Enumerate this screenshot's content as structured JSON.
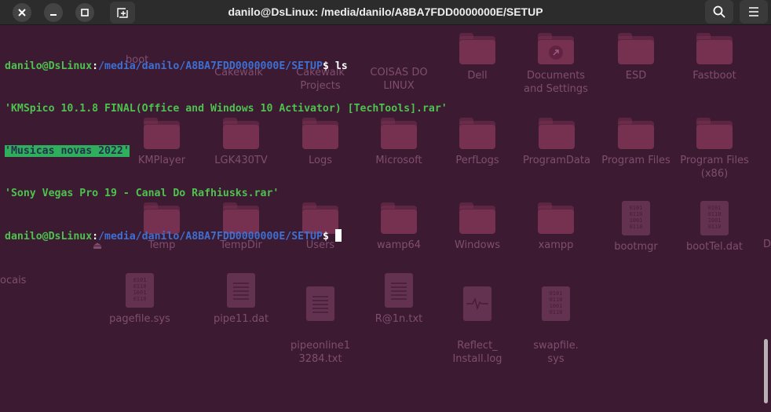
{
  "window": {
    "title": "danilo@DsLinux: /media/danilo/A8BA7FDD0000000E/SETUP"
  },
  "terminal": {
    "prompt_user": "danilo@DsLinux",
    "prompt_sep": ":",
    "prompt_path": "/media/danilo/A8BA7FDD0000000E/SETUP",
    "prompt_symbol": "$",
    "command": " ls",
    "output": [
      "'KMSpico 10.1.8 FINAL(Office and Windows 10 Activator) [TechTools].rar'",
      "'Musicas novas 2022'",
      "'Sony Vegas Pro 19 - Canal Do Rafhiusks.rar'"
    ],
    "colors": {
      "user": "#4ec24e",
      "path": "#3f6fd0",
      "highlight_bg": "#2fae5e",
      "background": "#3b1a32"
    }
  },
  "background_files": {
    "row1": [
      "Cakewalk",
      "Cakewalk Projects",
      "COISAS DO LINUX",
      "Dell",
      "Documents and Settings",
      "ESD",
      "Fastboot"
    ],
    "row1_partial": "boot",
    "row2": [
      "KMPlayer",
      "LGK430TV",
      "Logs",
      "Microsoft",
      "PerfLogs",
      "ProgramData",
      "Program Files",
      "Program Files (x86)"
    ],
    "row3": [
      "Temp",
      "TempDir",
      "Users",
      "wamp64",
      "Windows",
      "xampp",
      "bootmgr",
      "bootTel.dat"
    ],
    "row3_partial": "D",
    "row4": [
      "pagefile.sys",
      "pipe11.dat",
      "pipeonline13284.txt",
      "R@1n.txt",
      "Reflect_Install.log",
      "swapfile.sys"
    ],
    "row4_labels": [
      "pagefile.sys",
      "pipe11.dat",
      "pipeonline1\n3284.txt",
      "R@1n.txt",
      "Reflect_\nInstall.log",
      "swapfile.\nsys"
    ],
    "sidebar_partial": "ocais",
    "binary_glyph": "0101\n0110\n1001\n0110"
  }
}
